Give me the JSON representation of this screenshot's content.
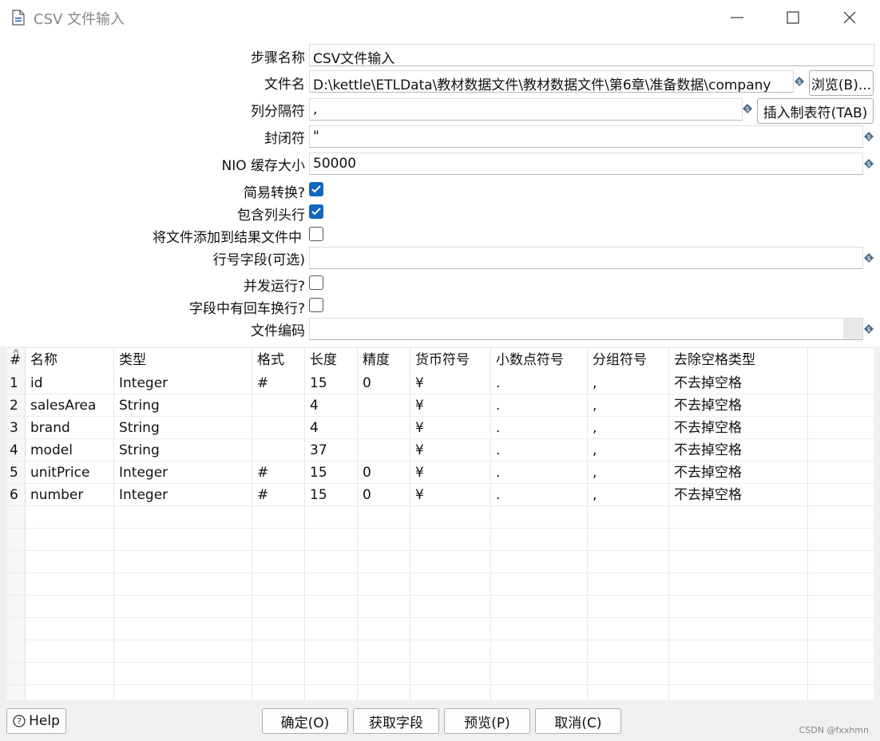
{
  "window": {
    "title": "CSV 文件输入"
  },
  "form": {
    "step_name": {
      "label": "步骤名称",
      "value": "CSV文件输入"
    },
    "file_name": {
      "label": "文件名",
      "value": "D:\\kettle\\ETLData\\教材数据文件\\教材数据文件\\第6章\\准备数据\\company",
      "button": "浏览(B)..."
    },
    "delimiter": {
      "label": "列分隔符",
      "value": ",",
      "button": "插入制表符(TAB)"
    },
    "enclosure": {
      "label": "封闭符",
      "value": "\""
    },
    "nio_buffer": {
      "label": "NIO 缓存大小",
      "value": "50000"
    },
    "lazy_conversion": {
      "label": "简易转换?",
      "checked": true
    },
    "header_row": {
      "label": "包含列头行",
      "checked": true
    },
    "add_to_result": {
      "label": "将文件添加到结果文件中",
      "checked": false
    },
    "row_num_field": {
      "label": "行号字段(可选)",
      "value": ""
    },
    "parallel": {
      "label": "并发运行?",
      "checked": false
    },
    "newlines": {
      "label": "字段中有回车换行?",
      "checked": false
    },
    "encoding": {
      "label": "文件编码",
      "value": ""
    }
  },
  "table": {
    "headers": [
      "#",
      "名称",
      "类型",
      "格式",
      "长度",
      "精度",
      "货币符号",
      "小数点符号",
      "分组符号",
      "去除空格类型"
    ],
    "rows": [
      [
        "1",
        "id",
        "Integer",
        "#",
        "15",
        "0",
        "¥",
        ".",
        ",",
        "不去掉空格"
      ],
      [
        "2",
        "salesArea",
        "String",
        "",
        "4",
        "",
        "¥",
        ".",
        ",",
        "不去掉空格"
      ],
      [
        "3",
        "brand",
        "String",
        "",
        "4",
        "",
        "¥",
        ".",
        ",",
        "不去掉空格"
      ],
      [
        "4",
        "model",
        "String",
        "",
        "37",
        "",
        "¥",
        ".",
        ",",
        "不去掉空格"
      ],
      [
        "5",
        "unitPrice",
        "Integer",
        "#",
        "15",
        "0",
        "¥",
        ".",
        ",",
        "不去掉空格"
      ],
      [
        "6",
        "number",
        "Integer",
        "#",
        "15",
        "0",
        "¥",
        ".",
        ",",
        "不去掉空格"
      ]
    ]
  },
  "buttons": {
    "help": "Help",
    "ok": "确定(O)",
    "get_fields": "获取字段",
    "preview": "预览(P)",
    "cancel": "取消(C)"
  },
  "watermark": "CSDN @fxxhmn",
  "colors": {
    "accent": "#1565c0"
  }
}
